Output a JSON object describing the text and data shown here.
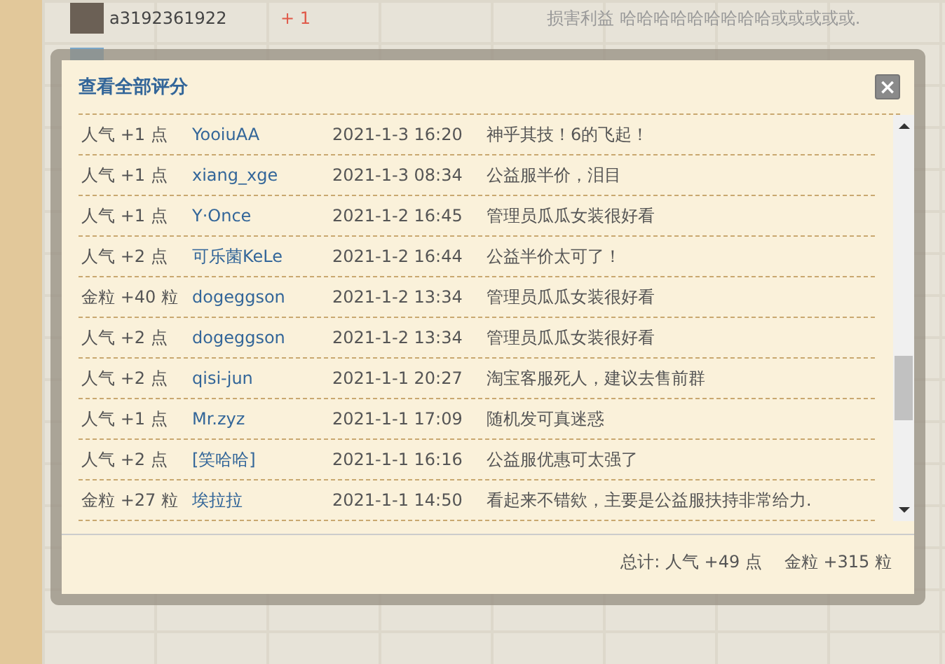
{
  "background_post": {
    "username": "a3192361922",
    "score": "+ 1",
    "comment": "损害利益 哈哈哈哈哈哈哈哈哈或或或或或."
  },
  "dialog": {
    "title": "查看全部评分",
    "close_label": "×",
    "ratings": [
      {
        "amount": "人气 +1 点",
        "user": "YooiuAA",
        "time": "2021-1-3 16:20",
        "reason": "神乎其技！6的飞起！"
      },
      {
        "amount": "人气 +1 点",
        "user": "xiang_xge",
        "time": "2021-1-3 08:34",
        "reason": "公益服半价，泪目"
      },
      {
        "amount": "人气 +1 点",
        "user": "Y·Once",
        "time": "2021-1-2 16:45",
        "reason": "管理员瓜瓜女装很好看"
      },
      {
        "amount": "人气 +2 点",
        "user": "可乐菌KeLe",
        "time": "2021-1-2 16:44",
        "reason": "公益半价太可了！"
      },
      {
        "amount": "金粒 +40 粒",
        "user": "dogeggson",
        "time": "2021-1-2 13:34",
        "reason": "管理员瓜瓜女装很好看"
      },
      {
        "amount": "人气 +2 点",
        "user": "dogeggson",
        "time": "2021-1-2 13:34",
        "reason": "管理员瓜瓜女装很好看"
      },
      {
        "amount": "人气 +2 点",
        "user": "qisi-jun",
        "time": "2021-1-1 20:27",
        "reason": "淘宝客服死人，建议去售前群"
      },
      {
        "amount": "人气 +1 点",
        "user": "Mr.zyz",
        "time": "2021-1-1 17:09",
        "reason": "随机发可真迷惑"
      },
      {
        "amount": "人气 +2 点",
        "user": "[笑哈哈]",
        "time": "2021-1-1 16:16",
        "reason": "公益服优惠可太强了"
      },
      {
        "amount": "金粒 +27 粒",
        "user": "埃拉拉",
        "time": "2021-1-1 14:50",
        "reason": "看起来不错欸，主要是公益服扶持非常给力."
      }
    ],
    "totals": {
      "label": "总计: 人气 +49 点",
      "gold": "金粒 +315 粒"
    }
  }
}
